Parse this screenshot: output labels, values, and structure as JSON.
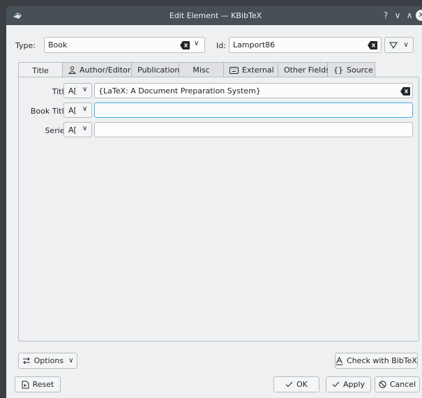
{
  "window": {
    "title": "Edit Element — KBibTeX",
    "help_glyph": "?",
    "min_glyph": "∨",
    "max_glyph": "∧",
    "close_glyph": "✕"
  },
  "top": {
    "type_label": "Type:",
    "type_value": "Book",
    "id_label": "Id:",
    "id_value": "Lamport86"
  },
  "tabs": [
    {
      "label": "Title",
      "icon": "none"
    },
    {
      "label": "Author/Editor",
      "icon": "person-icon"
    },
    {
      "label": "Publication",
      "icon": "none"
    },
    {
      "label": "Misc",
      "icon": "none"
    },
    {
      "label": "External",
      "icon": "keyboard-icon"
    },
    {
      "label": "Other Fields",
      "icon": "none"
    },
    {
      "label": "Source",
      "icon": "braces-icon"
    }
  ],
  "fields": [
    {
      "label": "Title:",
      "value": "{LaTeX: A Document Preparation System}",
      "format": "A[",
      "chevron": "∨"
    },
    {
      "label": "Book Title:",
      "value": "",
      "format": "A[",
      "chevron": "∨"
    },
    {
      "label": "Series:",
      "value": "",
      "format": "A[",
      "chevron": "∨"
    }
  ],
  "bottom": {
    "options_label": "Options",
    "options_chevron": "∨",
    "check_label": "Check with BibTeX",
    "reset_label": "Reset",
    "ok_label": "OK",
    "apply_label": "Apply",
    "cancel_label": "Cancel"
  },
  "colors": {
    "titlebar": "#475057",
    "window_bg": "#eff0f1",
    "focus": "#3daee9"
  }
}
